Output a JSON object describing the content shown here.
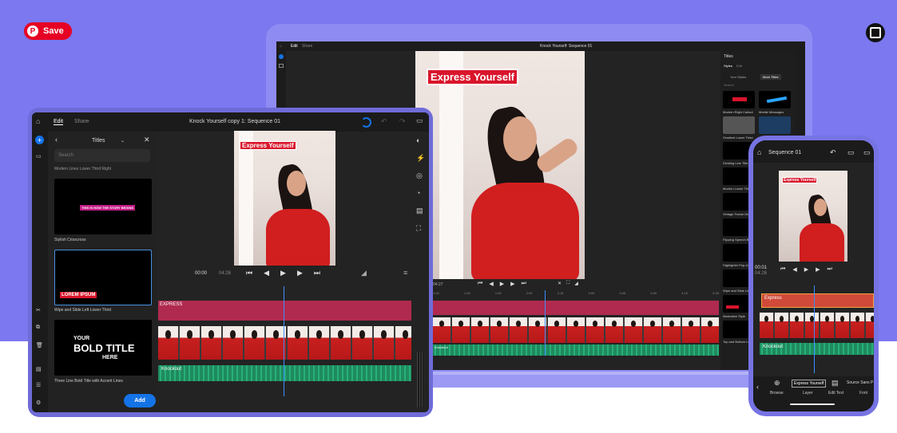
{
  "pin": {
    "save_label": "Save"
  },
  "laptop": {
    "tabs": [
      "Edit",
      "Share"
    ],
    "project_title": "Knock Yourself: Sequence 01",
    "panel_title": "Titles",
    "panel_tabs": [
      "Styles",
      "Edit"
    ],
    "panel_subtabs": [
      "Your Styles",
      "More Titles"
    ],
    "search_placeholder": "Search",
    "styles": [
      "Modern Right Callout",
      "Mobile Messages",
      "Gradient Lower Third",
      "",
      "Dividing Line Title",
      "",
      "Modern Lower Thi",
      "",
      "Vintage Frame Div",
      "",
      "Flipping Speech Bu",
      "",
      "Highlighter Pop-Up",
      "",
      "Wipe and Slide Lef",
      "",
      "Illustrative Style",
      "",
      "Top and Bottom Lo",
      ""
    ],
    "overlay_title": "Express Yourself",
    "timecode": "04:27",
    "ruler": [
      "1:00",
      "1:30",
      "1:45",
      "2:00",
      "2:15",
      "3:00",
      "3:45",
      "4:00",
      "4:15",
      "4:30"
    ],
    "audio_label": "Knockout"
  },
  "tablet": {
    "tabs": [
      "Edit",
      "Share"
    ],
    "project_title": "Knock Yourself copy 1: Sequence 01",
    "panel_title": "Titles",
    "search_placeholder": "Search",
    "top_label": "Modern Lines Lower Third Right",
    "items": [
      {
        "label": "Stylish Crisscross",
        "thumb_text": "THIS IS HOW THE STORY BEGINS"
      },
      {
        "label": "Wipe and Slide Left Lower Third",
        "thumb_text": "LOREM IPSUM"
      },
      {
        "label": "Three Line Bold Title with Accent Lines",
        "thumb_text_1": "YOUR",
        "thumb_text_2": "BOLD TITLE",
        "thumb_text_3": "HERE"
      }
    ],
    "add_label": "Add",
    "overlay_title": "Express Yourself",
    "time_current": "00:00",
    "time_total": "04:26",
    "title_track": "EXPRESS",
    "audio_label": "Knockout"
  },
  "phone": {
    "title": "Sequence 01",
    "overlay_title": "Express Yourself",
    "time_current": "00:01",
    "time_total": "04:26",
    "title_track": "Express",
    "audio_label": "Knockout",
    "toolbar": [
      "Browse",
      "Layer",
      "Edit Text",
      "Font"
    ],
    "layer_value": "Express Yourself",
    "font_value": "Source Sans P"
  },
  "colors": {
    "background": "#7b78f0",
    "accent_red": "#d9152b",
    "panel": "#232323",
    "title_track": "#b02a4f",
    "audio_track": "#1f8a5e",
    "add_button": "#1473e6"
  }
}
